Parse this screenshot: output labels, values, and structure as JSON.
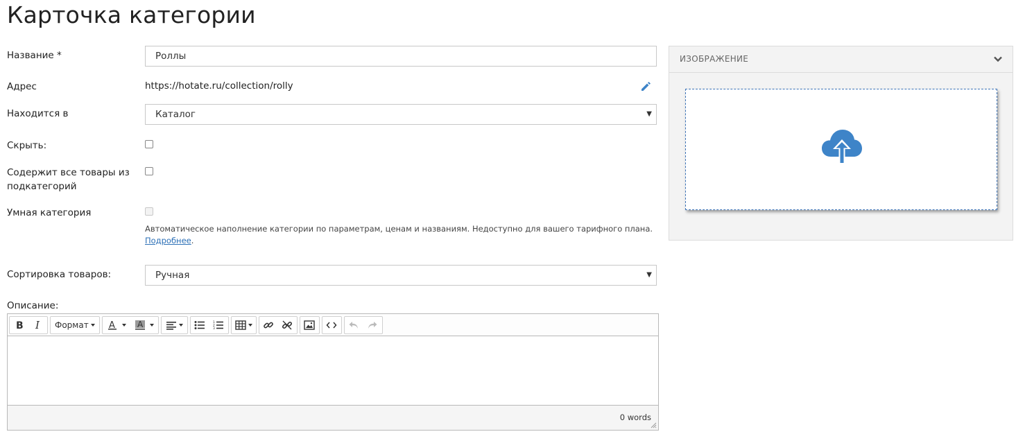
{
  "page": {
    "title": "Карточка категории"
  },
  "form": {
    "name_label": "Название *",
    "name_value": "Роллы",
    "address_label": "Адрес",
    "address_value": "https://hotate.ru/collection/rolly",
    "parent_label": "Находится в",
    "parent_value": "Каталог",
    "hide_label": "Скрыть:",
    "include_sub_label_line1": "Содержит все товары из",
    "include_sub_label_line2": "подкатегорий",
    "smart_label": "Умная категория",
    "smart_hint": "Автоматическое наполнение категории по параметрам, ценам и названиям. Недоступно для вашего тарифного плана.",
    "smart_more_link": "Подробнее",
    "smart_more_suffix": ".",
    "sort_label": "Сортировка товаров:",
    "sort_value": "Ручная",
    "description_label": "Описание:"
  },
  "editor": {
    "format_label": "Формат",
    "word_count": "0 words"
  },
  "image_panel": {
    "title": "ИЗОБРАЖЕНИЕ"
  },
  "icons": {
    "edit": "pencil-icon",
    "upload": "cloud-upload-icon",
    "collapse": "chevron-down-icon"
  },
  "colors": {
    "accent": "#3e84c8",
    "link": "#2b6fb6"
  }
}
